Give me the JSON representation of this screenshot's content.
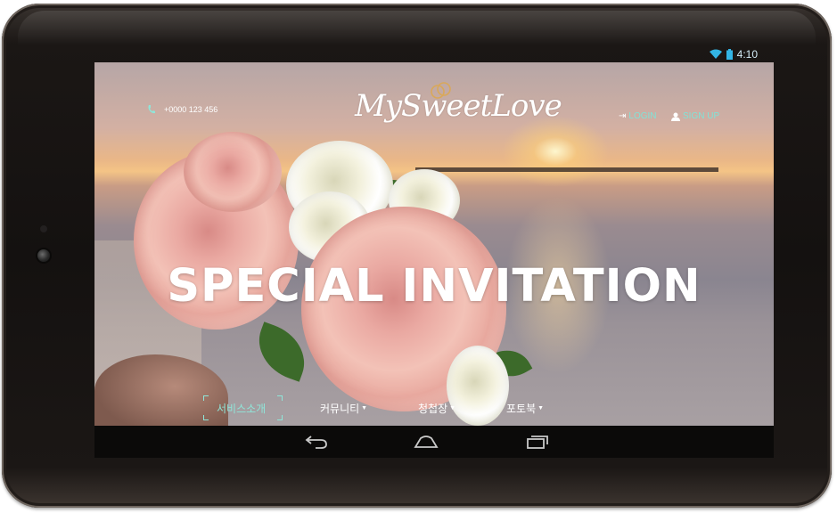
{
  "status_bar": {
    "time": "4:10",
    "icons": [
      "wifi-icon",
      "battery-icon"
    ]
  },
  "header": {
    "phone_icon": "phone-icon",
    "phone_number": "+0000 123 456",
    "logo_text": "MySweetLove",
    "login_icon": "login-icon",
    "login_label": "LOGIN",
    "signup_icon": "user-icon",
    "signup_label": "SIGN UP"
  },
  "hero": {
    "title": "SPECIAL INVITATION"
  },
  "nav": {
    "items": [
      {
        "label": "서비스소개",
        "has_dropdown": false,
        "active": true
      },
      {
        "label": "커뮤니티",
        "has_dropdown": true,
        "active": false
      },
      {
        "label": "청첩장",
        "has_dropdown": true,
        "active": false
      },
      {
        "label": "포토북",
        "has_dropdown": true,
        "active": false
      }
    ]
  },
  "softkeys": [
    "back-icon",
    "home-icon",
    "recent-apps-icon"
  ],
  "colors": {
    "accent": "#8fe6d9",
    "status_text": "#d4ecf7",
    "device": "#141110"
  }
}
